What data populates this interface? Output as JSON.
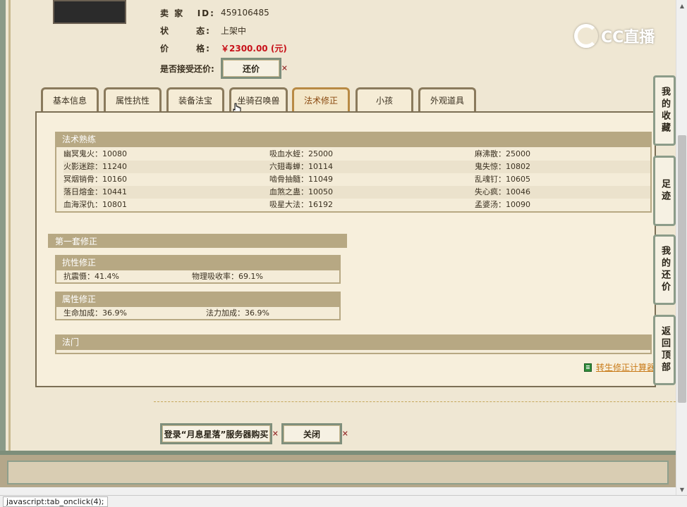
{
  "seller": {
    "id_label": "卖 家   ID:",
    "id_value": "459106485",
    "status_label": "状      态:",
    "status_value": "上架中",
    "price_label": "价      格:",
    "price_value": "￥2300.00 (元)",
    "counter_offer_label": "是否接受还价:",
    "counter_offer_button": "还价"
  },
  "tabs": [
    {
      "label": "基本信息"
    },
    {
      "label": "属性抗性"
    },
    {
      "label": "装备法宝"
    },
    {
      "label": "坐骑召唤兽"
    },
    {
      "label": "法术修正"
    },
    {
      "label": "小孩"
    },
    {
      "label": "外观道具"
    }
  ],
  "active_tab": "法术修正",
  "spell_mastery": {
    "title": "法术熟练",
    "rows": [
      [
        "幽冥鬼火：10080",
        "吸血水蛭：25000",
        "麻沸散：25000"
      ],
      [
        "火影迷踪：11240",
        "六翅毒蝉：10114",
        "鬼失惊：10802"
      ],
      [
        "冥烟销骨：10160",
        "啮骨抽髓：11049",
        "乱魂钉：10605"
      ],
      [
        "落日熔金：10441",
        "血煞之蛊：10050",
        "失心疯：10046"
      ],
      [
        "血海深仇：10801",
        "吸星大法：16192",
        "孟婆汤：10090"
      ]
    ]
  },
  "first_correction": {
    "title": "第一套修正",
    "resistance": {
      "title": "抗性修正",
      "items": [
        "抗震慑：41.4%",
        "物理吸收率：69.1%"
      ]
    },
    "attribute": {
      "title": "属性修正",
      "items": [
        "生命加成：36.9%",
        "法力加成：36.9%"
      ]
    }
  },
  "school": {
    "title": "法门"
  },
  "calc_link": "转生修正计算器",
  "bottom_buttons": {
    "login_buy": "登录“月息星落”服务器购买",
    "close": "关闭"
  },
  "side_nav": [
    {
      "label": "我的收藏"
    },
    {
      "label": "足迹"
    },
    {
      "label": "我的还价"
    },
    {
      "label": "返回顶部"
    }
  ],
  "watermark": "CC直播",
  "status_bar": "javascript:tab_onclick(4);"
}
